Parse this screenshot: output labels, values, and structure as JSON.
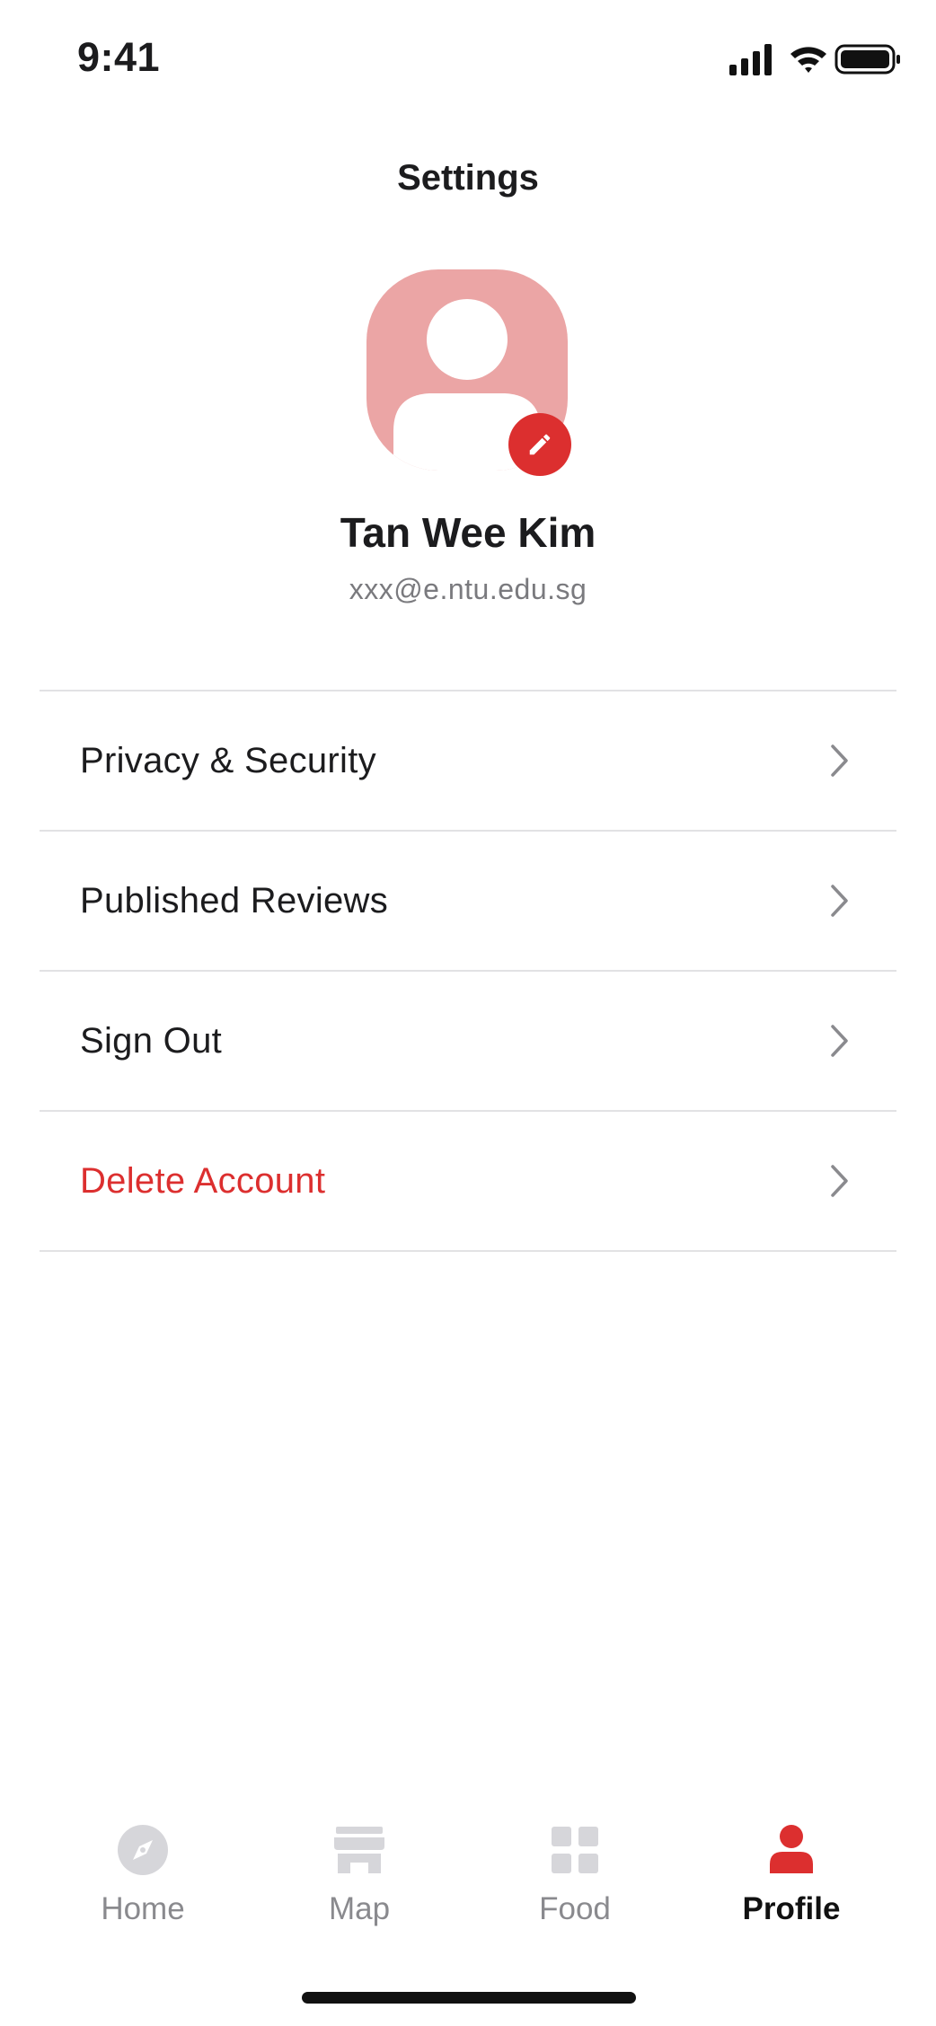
{
  "status_bar": {
    "time": "9:41"
  },
  "page": {
    "title": "Settings"
  },
  "profile": {
    "name": "Tan Wee Kim",
    "email": "xxx@e.ntu.edu.sg"
  },
  "menu": {
    "items": [
      {
        "label": "Privacy & Security"
      },
      {
        "label": "Published Reviews"
      },
      {
        "label": "Sign Out"
      },
      {
        "label": "Delete Account"
      }
    ]
  },
  "tabs": [
    {
      "label": "Home",
      "icon": "compass-icon",
      "active": false
    },
    {
      "label": "Map",
      "icon": "store-icon",
      "active": false
    },
    {
      "label": "Food",
      "icon": "grid-icon",
      "active": false
    },
    {
      "label": "Profile",
      "icon": "person-icon",
      "active": true
    }
  ],
  "colors": {
    "accent": "#dc2f2f",
    "avatar_bg": "#eba5a5",
    "inactive_tab": "#d6d6da"
  }
}
